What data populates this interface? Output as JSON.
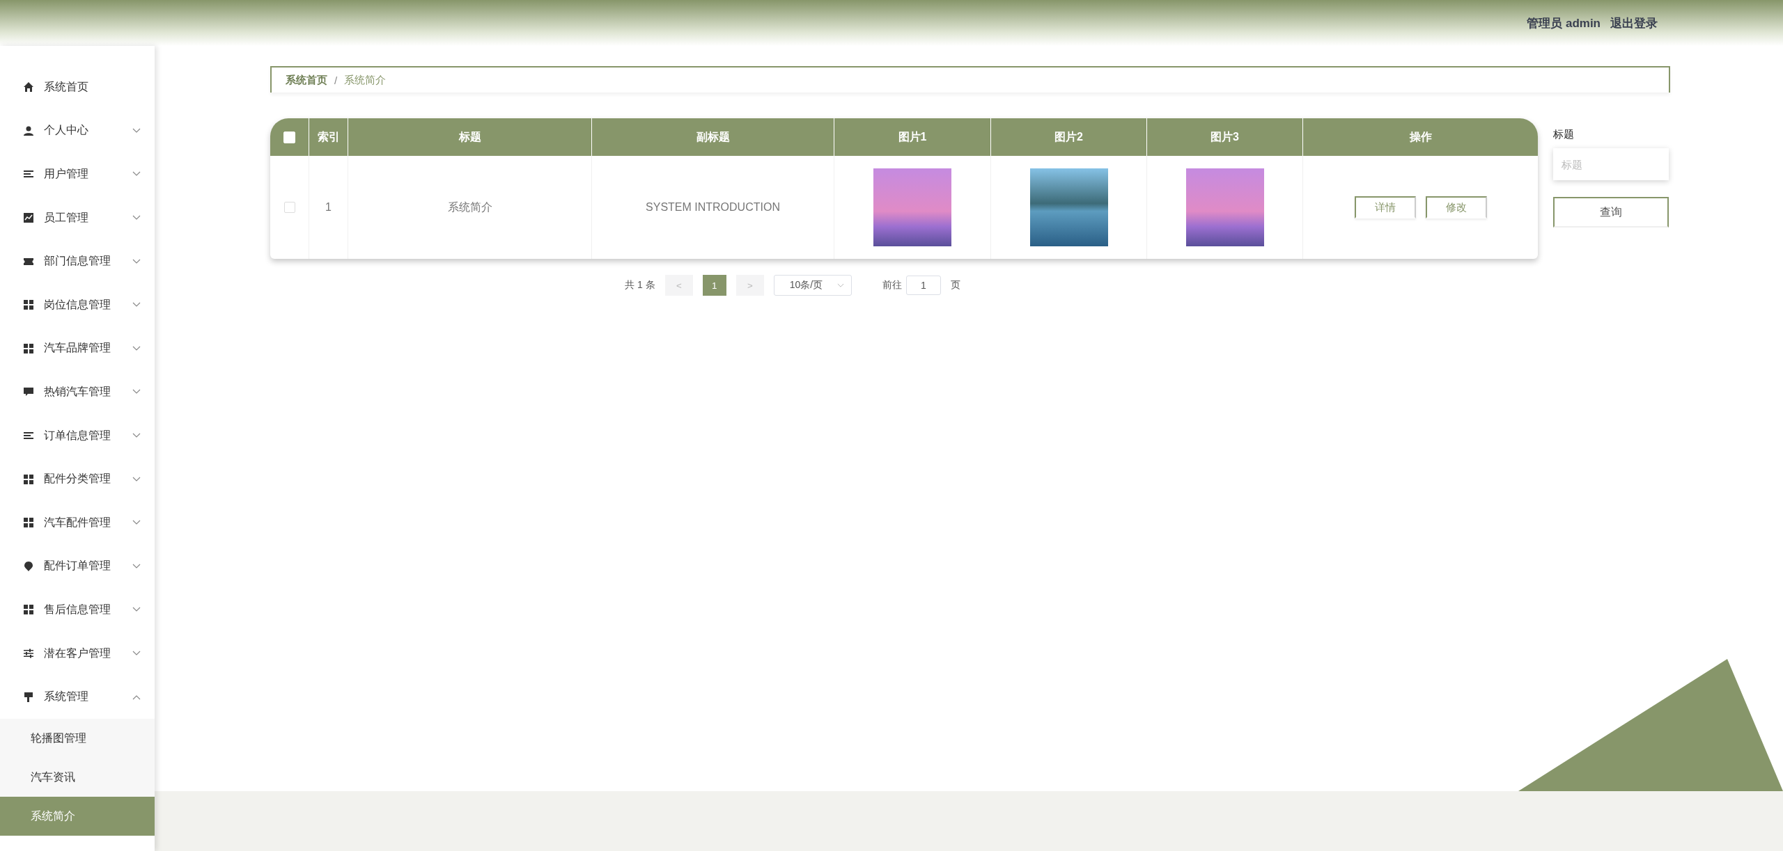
{
  "header": {
    "user_label": "管理员 admin",
    "logout": "退出登录"
  },
  "sidebar": {
    "items": [
      {
        "label": "系统首页",
        "kind": "link"
      },
      {
        "label": "个人中心",
        "kind": "submenu",
        "expanded": false
      },
      {
        "label": "用户管理",
        "kind": "submenu",
        "expanded": false
      },
      {
        "label": "员工管理",
        "kind": "submenu",
        "expanded": false
      },
      {
        "label": "部门信息管理",
        "kind": "submenu",
        "expanded": false
      },
      {
        "label": "岗位信息管理",
        "kind": "submenu",
        "expanded": false
      },
      {
        "label": "汽车品牌管理",
        "kind": "submenu",
        "expanded": false
      },
      {
        "label": "热销汽车管理",
        "kind": "submenu",
        "expanded": false
      },
      {
        "label": "订单信息管理",
        "kind": "submenu",
        "expanded": false
      },
      {
        "label": "配件分类管理",
        "kind": "submenu",
        "expanded": false
      },
      {
        "label": "汽车配件管理",
        "kind": "submenu",
        "expanded": false
      },
      {
        "label": "配件订单管理",
        "kind": "submenu",
        "expanded": false
      },
      {
        "label": "售后信息管理",
        "kind": "submenu",
        "expanded": false
      },
      {
        "label": "潜在客户管理",
        "kind": "submenu",
        "expanded": false
      },
      {
        "label": "系统管理",
        "kind": "submenu",
        "expanded": true,
        "children": [
          {
            "label": "轮播图管理",
            "selected": false
          },
          {
            "label": "汽车资讯",
            "selected": false
          },
          {
            "label": "系统简介",
            "selected": true
          }
        ]
      }
    ]
  },
  "breadcrumb": {
    "separator": "/",
    "items": [
      "系统首页",
      "系统简介"
    ]
  },
  "table": {
    "header_checkbox": {
      "checked": false
    },
    "columns": [
      "索引",
      "标题",
      "副标题",
      "图片1",
      "图片2",
      "图片3",
      "操作"
    ],
    "rows": [
      {
        "checked": false,
        "index": "1",
        "title": "系统简介",
        "subtitle": "SYSTEM INTRODUCTION",
        "actions": [
          "详情",
          "修改"
        ]
      }
    ]
  },
  "pagination": {
    "total": "共 1 条",
    "prev": "<",
    "pages": [
      {
        "label": "1",
        "selected": true
      }
    ],
    "next": ">",
    "page_size": "10条/页",
    "goto_label": "前往",
    "goto_value": "1",
    "page_suffix": "页"
  },
  "search": {
    "label": "标题",
    "placeholder": "标题",
    "button": "查询"
  }
}
